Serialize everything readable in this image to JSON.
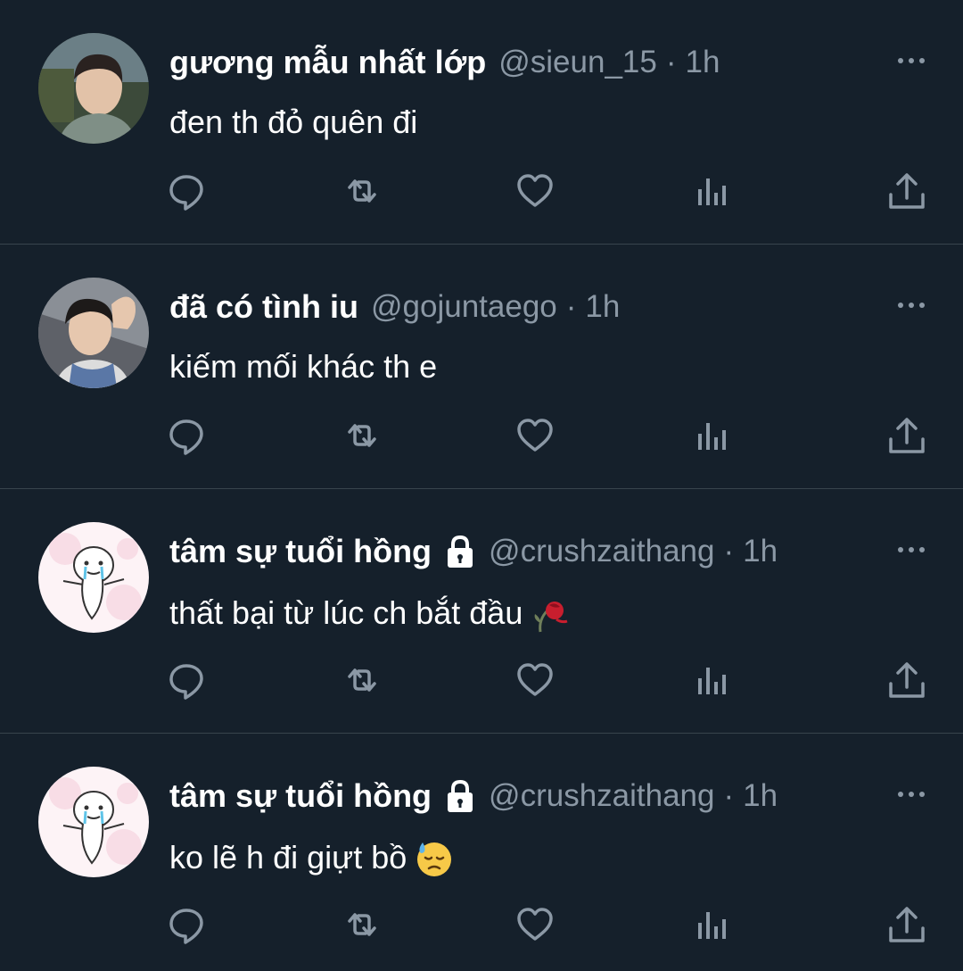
{
  "colors": {
    "background": "#15202b",
    "divider": "#38444d",
    "secondary_text": "#8b98a5",
    "primary_text": "#ffffff"
  },
  "tweets": [
    {
      "display_name": "gương mẫu nhất lớp",
      "handle": "@sieun_15",
      "separator": "·",
      "time": "1h",
      "text": "đen th đỏ quên đi",
      "protected": false,
      "avatar": "photo-avatar",
      "emoji": null
    },
    {
      "display_name": "đã có tình iu",
      "handle": "@gojuntaego",
      "separator": "·",
      "time": "1h",
      "text": "kiếm mối khác th e",
      "protected": false,
      "avatar": "photo-avatar",
      "emoji": null
    },
    {
      "display_name": "tâm sự tuổi hồng",
      "handle": "@crushzaithang",
      "separator": "·",
      "time": "1h",
      "text": "thất bại từ lúc ch bắt đầu",
      "protected": true,
      "avatar": "cartoon-avatar",
      "emoji": "wilted-flower-emoji"
    },
    {
      "display_name": "tâm sự tuổi hồng",
      "handle": "@crushzaithang",
      "separator": "·",
      "time": "1h",
      "text": "ko lẽ h đi giựt bồ",
      "protected": true,
      "avatar": "cartoon-avatar",
      "emoji": "downcast-sweat-emoji"
    }
  ],
  "action_icons": [
    "reply-icon",
    "retweet-icon",
    "like-icon",
    "analytics-icon",
    "share-icon"
  ]
}
